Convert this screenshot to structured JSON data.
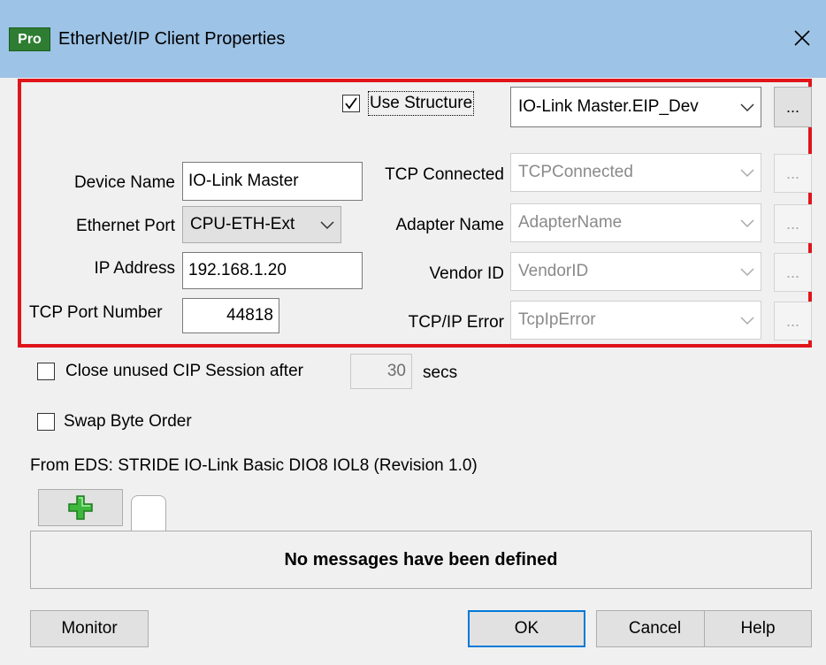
{
  "window": {
    "title": "EtherNet/IP Client Properties",
    "logo": "Pro",
    "close_glyph": "✕"
  },
  "structure": {
    "use_structure_label": "Use Structure",
    "use_structure_checked": true,
    "structure_value": "IO-Link Master.EIP_Dev",
    "ellipsis": "..."
  },
  "left_fields": {
    "device_name_label": "Device Name",
    "device_name_value": "IO-Link Master",
    "ethernet_port_label": "Ethernet Port",
    "ethernet_port_value": "CPU-ETH-Ext",
    "ip_address_label": "IP Address",
    "ip_address_value": "192.168.1.20",
    "tcp_port_label": "TCP Port Number",
    "tcp_port_value": "44818"
  },
  "right_fields": [
    {
      "label": "TCP Connected",
      "value": "TCPConnected"
    },
    {
      "label": "Adapter Name",
      "value": "AdapterName"
    },
    {
      "label": "Vendor ID",
      "value": "VendorID"
    },
    {
      "label": "TCP/IP Error",
      "value": "TcpIpError"
    }
  ],
  "session": {
    "close_label": "Close unused CIP Session after",
    "close_checked": false,
    "seconds_value": "30",
    "secs_label": "secs"
  },
  "swap": {
    "label": "Swap Byte Order",
    "checked": false
  },
  "eds": {
    "text": "From EDS: STRIDE IO-Link Basic DIO8 IOL8 (Revision 1.0)"
  },
  "messages": {
    "empty_text": "No messages have been defined"
  },
  "buttons": {
    "monitor": "Monitor",
    "ok": "OK",
    "cancel": "Cancel",
    "help": "Help"
  },
  "colors": {
    "titlebar": "#9dc3e6",
    "highlight_border": "#e0151b",
    "plus_icon": "#3db83d"
  }
}
